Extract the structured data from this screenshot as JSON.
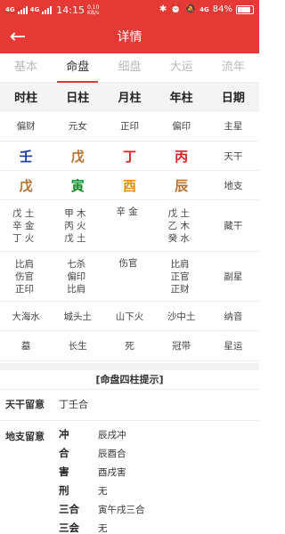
{
  "status_bar": {
    "sim1": "4G",
    "sim2": "4G",
    "time": "14:15",
    "speed_value": "0.10",
    "speed_unit": "KB/s",
    "battery": "84%",
    "network": "4G"
  },
  "header": {
    "back_icon": "arrow-left-icon",
    "title": "详情",
    "color": "#e53935"
  },
  "tabs": [
    "基本",
    "命盘",
    "细盘",
    "大运",
    "流年"
  ],
  "active_tab": "命盘",
  "grid": {
    "headers": [
      "时柱",
      "日柱",
      "月柱",
      "年柱",
      "日期"
    ],
    "rows": [
      {
        "cells": [
          "偏财",
          "元女",
          "正印",
          "偏印"
        ],
        "label": "主星"
      },
      {
        "cells": [
          "壬",
          "戊",
          "丁",
          "丙"
        ],
        "label": "天干"
      },
      {
        "cells": [
          "戊",
          "寅",
          "酉",
          "辰"
        ],
        "label": "地支"
      },
      {
        "cells": [
          [
            "戊 土",
            "辛 金",
            "丁 火"
          ],
          [
            "甲 木",
            "丙 火",
            "戊 土"
          ],
          [
            "辛 金"
          ],
          [
            "戊 土",
            "乙 木",
            "癸 水"
          ]
        ],
        "label": "藏干"
      },
      {
        "cells": [
          [
            "比肩",
            "伤官",
            "正印"
          ],
          [
            "七杀",
            "偏印",
            "比肩"
          ],
          [
            "伤官"
          ],
          [
            "比肩",
            "正官",
            "正财"
          ]
        ],
        "label": "副星"
      },
      {
        "cells": [
          "大海水",
          "城头土",
          "山下火",
          "沙中土"
        ],
        "label": "纳音"
      },
      {
        "cells": [
          "墓",
          "长生",
          "死",
          "冠带"
        ],
        "label": "星运"
      }
    ]
  },
  "tips": {
    "title": "[命盘四柱提示]",
    "tiangan_label": "天干留意",
    "tiangan_value": "丁壬合",
    "dizhi_label": "地支留意",
    "dizhi_items": [
      {
        "k": "冲",
        "v": "辰戌冲"
      },
      {
        "k": "合",
        "v": "辰酉合"
      },
      {
        "k": "害",
        "v": "酉戌害"
      },
      {
        "k": "刑",
        "v": "无"
      },
      {
        "k": "三合",
        "v": "寅午戌三合"
      },
      {
        "k": "三会",
        "v": "无"
      }
    ]
  }
}
